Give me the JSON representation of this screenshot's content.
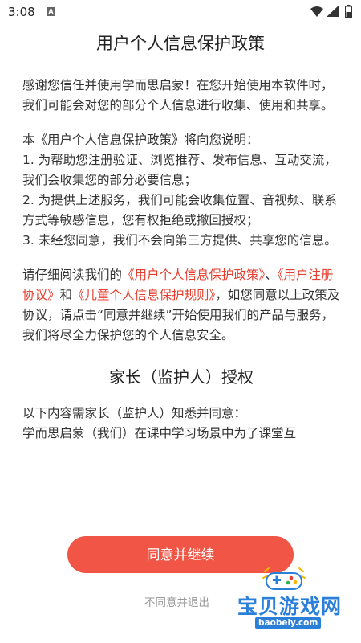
{
  "status_bar": {
    "time": "3:08",
    "notification_icon_letter": "A"
  },
  "dialog": {
    "title": "用户个人信息保护政策",
    "intro": "感谢您信任并使用学而思启蒙！在您开始使用本软件时，我们可能会对您的部分个人信息进行收集、使用和共享。",
    "explain_heading": "本《用户个人信息保护政策》将向您说明：",
    "points": [
      "1. 为帮助您注册验证、浏览推荐、发布信息、互动交流，我们会收集您的部分必要信息；",
      "2. 为提供上述服务，我们可能会收集位置、音视频、联系方式等敏感信息，您有权拒绝或撤回授权；",
      "3. 未经您同意，我们不会向第三方提供、共享您的信息。"
    ],
    "read_prefix": "请仔细阅读我们的",
    "link_policy": "《用户个人信息保护政策》",
    "sep1": "、",
    "link_register": "《用户注册协议》",
    "and": "和",
    "link_children": "《儿童个人信息保护规则》",
    "read_suffix": "，如您同意以上政策及协议，请点击“同意并继续”开始使用我们的产品与服务，我们将尽全力保护您的个人信息安全。",
    "guardian_title": "家长（监护人）授权",
    "guardian_text": "以下内容需家长（监护人）知悉并同意：",
    "guardian_text2": "学而思启蒙（我们）在课中学习场景中为了课堂互",
    "agree_button": "同意并继续",
    "reject_link": "不同意并退出"
  },
  "watermark": {
    "text": "宝贝游戏网",
    "url": "baobeiy.com"
  },
  "colors": {
    "accent": "#f05545",
    "link": "#e53d2e",
    "watermark_blue": "#2a7fd8"
  }
}
